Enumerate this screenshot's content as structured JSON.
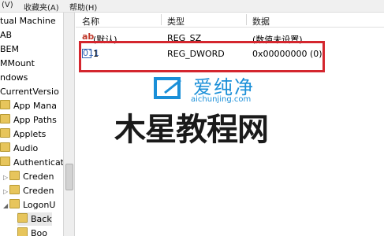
{
  "menu": {
    "partial_left": "(V)",
    "favorites": "收藏夹(A)",
    "help": "帮助(H)"
  },
  "tree": {
    "items": [
      {
        "label": "tual Machine"
      },
      {
        "label": "AB"
      },
      {
        "label": "BEM"
      },
      {
        "label": "MMount"
      },
      {
        "label": "ndows"
      },
      {
        "label": "CurrentVersio"
      },
      {
        "label": "App Mana"
      },
      {
        "label": "App Paths"
      },
      {
        "label": "Applets"
      },
      {
        "label": "Audio"
      },
      {
        "label": "Authenticat"
      },
      {
        "label": "Creden"
      },
      {
        "label": "Creden"
      },
      {
        "label": "LogonU"
      },
      {
        "label": "Back"
      },
      {
        "label": "Boo"
      }
    ]
  },
  "list": {
    "headers": {
      "name": "名称",
      "type": "类型",
      "data": "数据"
    },
    "rows": [
      {
        "icon": "string-value-icon",
        "icon_text": "ab",
        "name": "(默认)",
        "type": "REG_SZ",
        "data": "(数值未设置)"
      },
      {
        "icon": "binary-value-icon",
        "icon_text": "011",
        "name": "1",
        "type": "REG_DWORD",
        "data": "0x00000000 (0)"
      }
    ]
  },
  "watermark": {
    "brand": "爱纯净",
    "url": "aichunjing.com",
    "big_text": "木星教程网"
  },
  "colors": {
    "highlight_box": "#d4262e",
    "watermark_blue": "#1a8fd8",
    "folder": "#e7c55c"
  }
}
